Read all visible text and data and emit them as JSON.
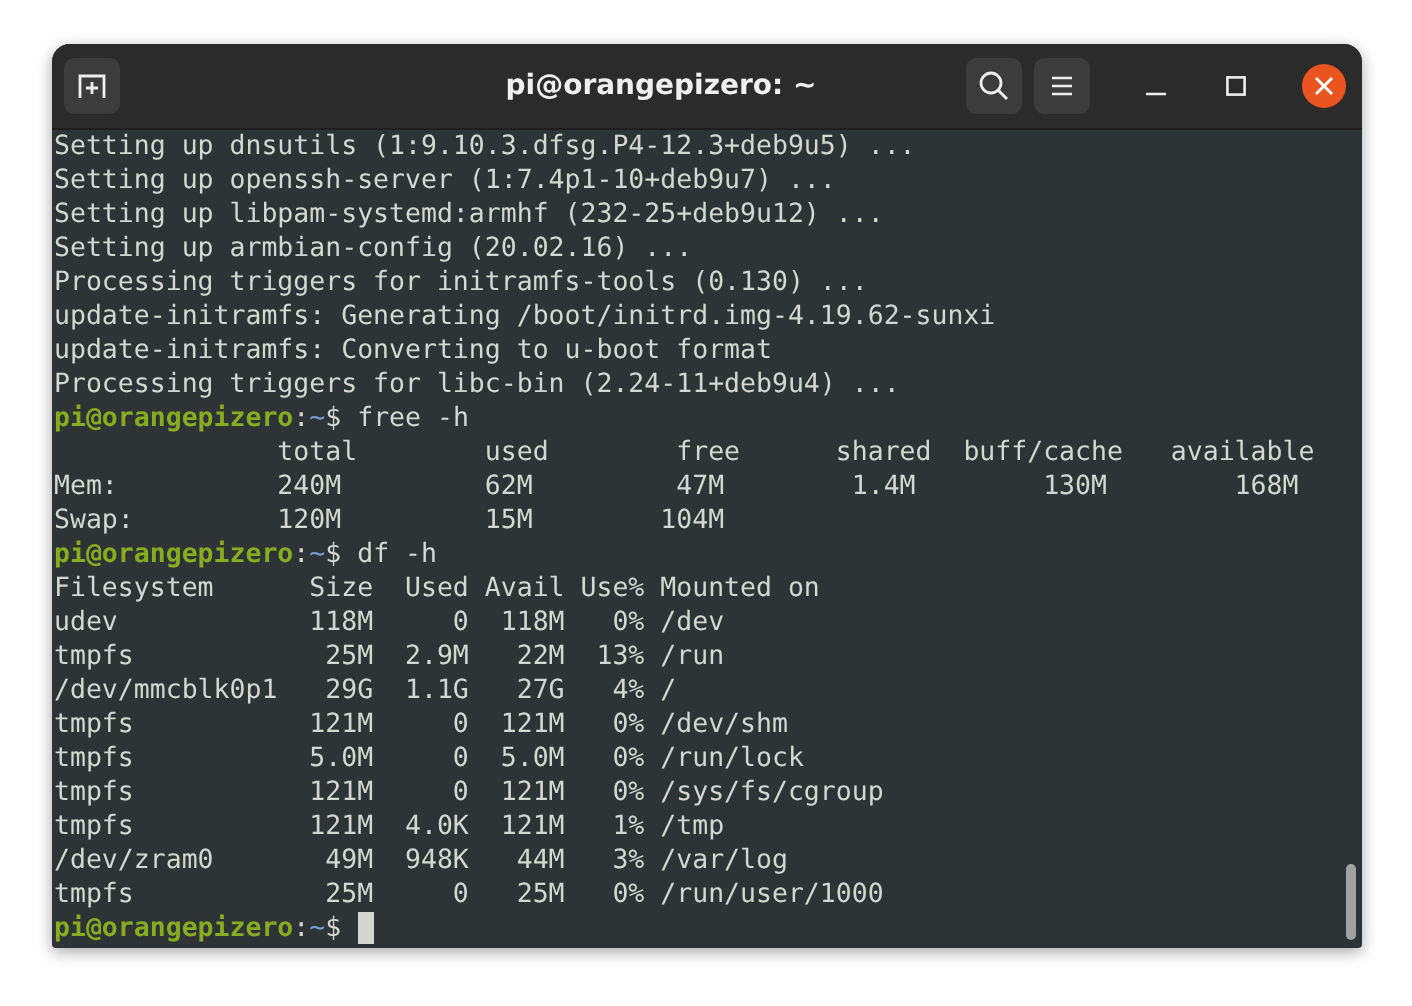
{
  "window": {
    "title": "pi@orangepizero: ~"
  },
  "terminal": {
    "lines": [
      {
        "kind": "output",
        "text": "Setting up dnsutils (1:9.10.3.dfsg.P4-12.3+deb9u5) ..."
      },
      {
        "kind": "output",
        "text": "Setting up openssh-server (1:7.4p1-10+deb9u7) ..."
      },
      {
        "kind": "output",
        "text": "Setting up libpam-systemd:armhf (232-25+deb9u12) ..."
      },
      {
        "kind": "output",
        "text": "Setting up armbian-config (20.02.16) ..."
      },
      {
        "kind": "output",
        "text": "Processing triggers for initramfs-tools (0.130) ..."
      },
      {
        "kind": "output",
        "text": "update-initramfs: Generating /boot/initrd.img-4.19.62-sunxi"
      },
      {
        "kind": "output",
        "text": "update-initramfs: Converting to u-boot format"
      },
      {
        "kind": "output",
        "text": "Processing triggers for libc-bin (2.24-11+deb9u4) ..."
      },
      {
        "kind": "prompt",
        "user": "pi@orangepizero",
        "sep": ":",
        "path": "~",
        "command": "$ free -h",
        "cursor": false
      },
      {
        "kind": "output",
        "text": "              total        used        free      shared  buff/cache   available"
      },
      {
        "kind": "output",
        "text": "Mem:          240M         62M         47M        1.4M        130M        168M"
      },
      {
        "kind": "output",
        "text": "Swap:         120M         15M        104M"
      },
      {
        "kind": "prompt",
        "user": "pi@orangepizero",
        "sep": ":",
        "path": "~",
        "command": "$ df -h",
        "cursor": false
      },
      {
        "kind": "output",
        "text": "Filesystem      Size  Used Avail Use% Mounted on"
      },
      {
        "kind": "output",
        "text": "udev            118M     0  118M   0% /dev"
      },
      {
        "kind": "output",
        "text": "tmpfs            25M  2.9M   22M  13% /run"
      },
      {
        "kind": "output",
        "text": "/dev/mmcblk0p1   29G  1.1G   27G   4% /"
      },
      {
        "kind": "output",
        "text": "tmpfs           121M     0  121M   0% /dev/shm"
      },
      {
        "kind": "output",
        "text": "tmpfs           5.0M     0  5.0M   0% /run/lock"
      },
      {
        "kind": "output",
        "text": "tmpfs           121M     0  121M   0% /sys/fs/cgroup"
      },
      {
        "kind": "output",
        "text": "tmpfs           121M  4.0K  121M   1% /tmp"
      },
      {
        "kind": "output",
        "text": "/dev/zram0       49M  948K   44M   3% /var/log"
      },
      {
        "kind": "output",
        "text": "tmpfs            25M     0   25M   0% /run/user/1000"
      },
      {
        "kind": "prompt",
        "user": "pi@orangepizero",
        "sep": ":",
        "path": "~",
        "command": "$",
        "cursor": true
      }
    ]
  }
}
